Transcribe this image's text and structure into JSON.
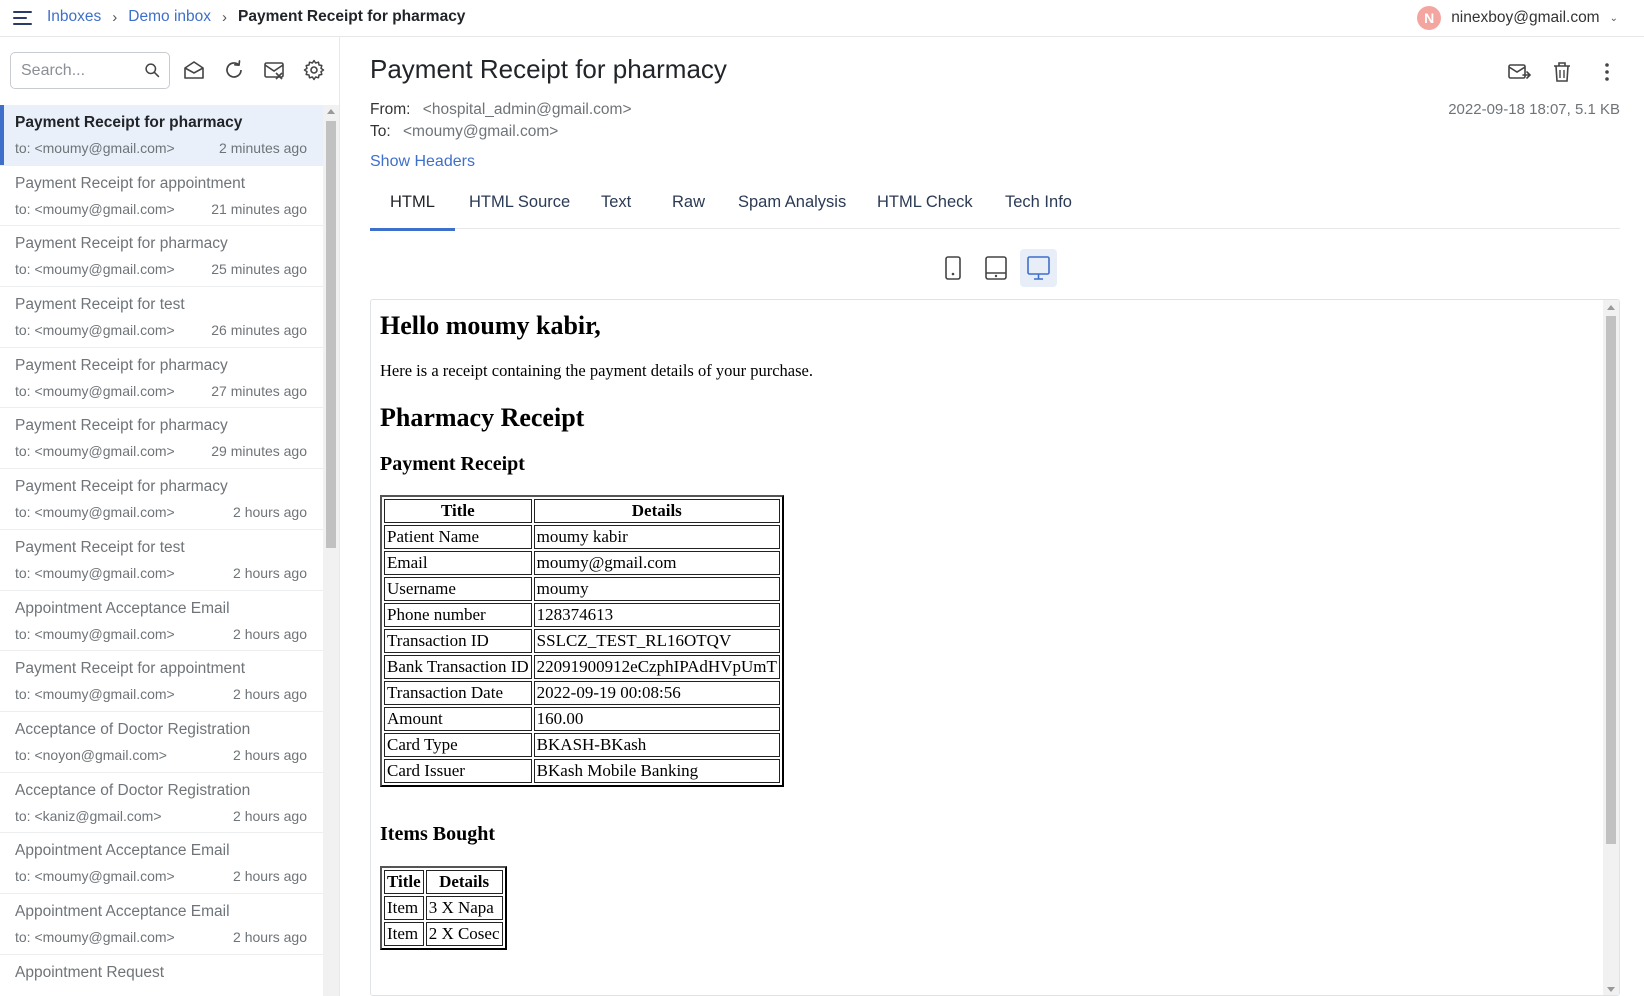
{
  "header": {
    "breadcrumb": [
      "Inboxes",
      "Demo inbox",
      "Payment Receipt for pharmacy"
    ],
    "user_initial": "N",
    "user_email": "ninexboy@gmail.com"
  },
  "search": {
    "placeholder": "Search..."
  },
  "messages": [
    {
      "subject": "Payment Receipt for pharmacy",
      "to": "to: <moumy@gmail.com>",
      "time": "2 minutes ago"
    },
    {
      "subject": "Payment Receipt for appointment",
      "to": "to: <moumy@gmail.com>",
      "time": "21 minutes ago"
    },
    {
      "subject": "Payment Receipt for pharmacy",
      "to": "to: <moumy@gmail.com>",
      "time": "25 minutes ago"
    },
    {
      "subject": "Payment Receipt for test",
      "to": "to: <moumy@gmail.com>",
      "time": "26 minutes ago"
    },
    {
      "subject": "Payment Receipt for pharmacy",
      "to": "to: <moumy@gmail.com>",
      "time": "27 minutes ago"
    },
    {
      "subject": "Payment Receipt for pharmacy",
      "to": "to: <moumy@gmail.com>",
      "time": "29 minutes ago"
    },
    {
      "subject": "Payment Receipt for pharmacy",
      "to": "to: <moumy@gmail.com>",
      "time": "2 hours ago"
    },
    {
      "subject": "Payment Receipt for test",
      "to": "to: <moumy@gmail.com>",
      "time": "2 hours ago"
    },
    {
      "subject": "Appointment Acceptance Email",
      "to": "to: <moumy@gmail.com>",
      "time": "2 hours ago"
    },
    {
      "subject": "Payment Receipt for appointment",
      "to": "to: <moumy@gmail.com>",
      "time": "2 hours ago"
    },
    {
      "subject": "Acceptance of Doctor Registration",
      "to": "to: <noyon@gmail.com>",
      "time": "2 hours ago"
    },
    {
      "subject": "Acceptance of Doctor Registration",
      "to": "to: <kaniz@gmail.com>",
      "time": "2 hours ago"
    },
    {
      "subject": "Appointment Acceptance Email",
      "to": "to: <moumy@gmail.com>",
      "time": "2 hours ago"
    },
    {
      "subject": "Appointment Acceptance Email",
      "to": "to: <moumy@gmail.com>",
      "time": "2 hours ago"
    },
    {
      "subject": "Appointment Request",
      "to": "",
      "time": ""
    }
  ],
  "email": {
    "subject": "Payment Receipt for pharmacy",
    "from_label": "From:",
    "from_value": "<hospital_admin@gmail.com>",
    "to_label": "To:",
    "to_value": "<moumy@gmail.com>",
    "date_size": "2022-09-18 18:07, 5.1 KB",
    "show_headers": "Show Headers"
  },
  "tabs": [
    "HTML",
    "HTML Source",
    "Text",
    "Raw",
    "Spam Analysis",
    "HTML Check",
    "Tech Info"
  ],
  "active_tab": "HTML",
  "body": {
    "greeting": "Hello moumy kabir,",
    "intro": "Here is a receipt containing the payment details of your purchase.",
    "heading": "Pharmacy Receipt",
    "payment_heading": "Payment Receipt",
    "payment_table": {
      "headers": [
        "Title",
        "Details"
      ],
      "rows": [
        [
          "Patient Name",
          "moumy kabir"
        ],
        [
          "Email",
          "moumy@gmail.com"
        ],
        [
          "Username",
          "moumy"
        ],
        [
          "Phone number",
          "128374613"
        ],
        [
          "Transaction ID",
          "SSLCZ_TEST_RL16OTQV"
        ],
        [
          "Bank Transaction ID",
          "22091900912eCzphIPAdHVpUmT"
        ],
        [
          "Transaction Date",
          "2022-09-19 00:08:56"
        ],
        [
          "Amount",
          "160.00"
        ],
        [
          "Card Type",
          "BKASH-BKash"
        ],
        [
          "Card Issuer",
          "BKash Mobile Banking"
        ]
      ]
    },
    "items_heading": "Items Bought",
    "items_table": {
      "headers": [
        "Title",
        "Details"
      ],
      "rows": [
        [
          "Item",
          "3 X Napa"
        ],
        [
          "Item",
          "2 X Cosec"
        ]
      ]
    }
  },
  "colors": {
    "accent": "#3e6fcb",
    "avatar": "#f3a6a0"
  }
}
